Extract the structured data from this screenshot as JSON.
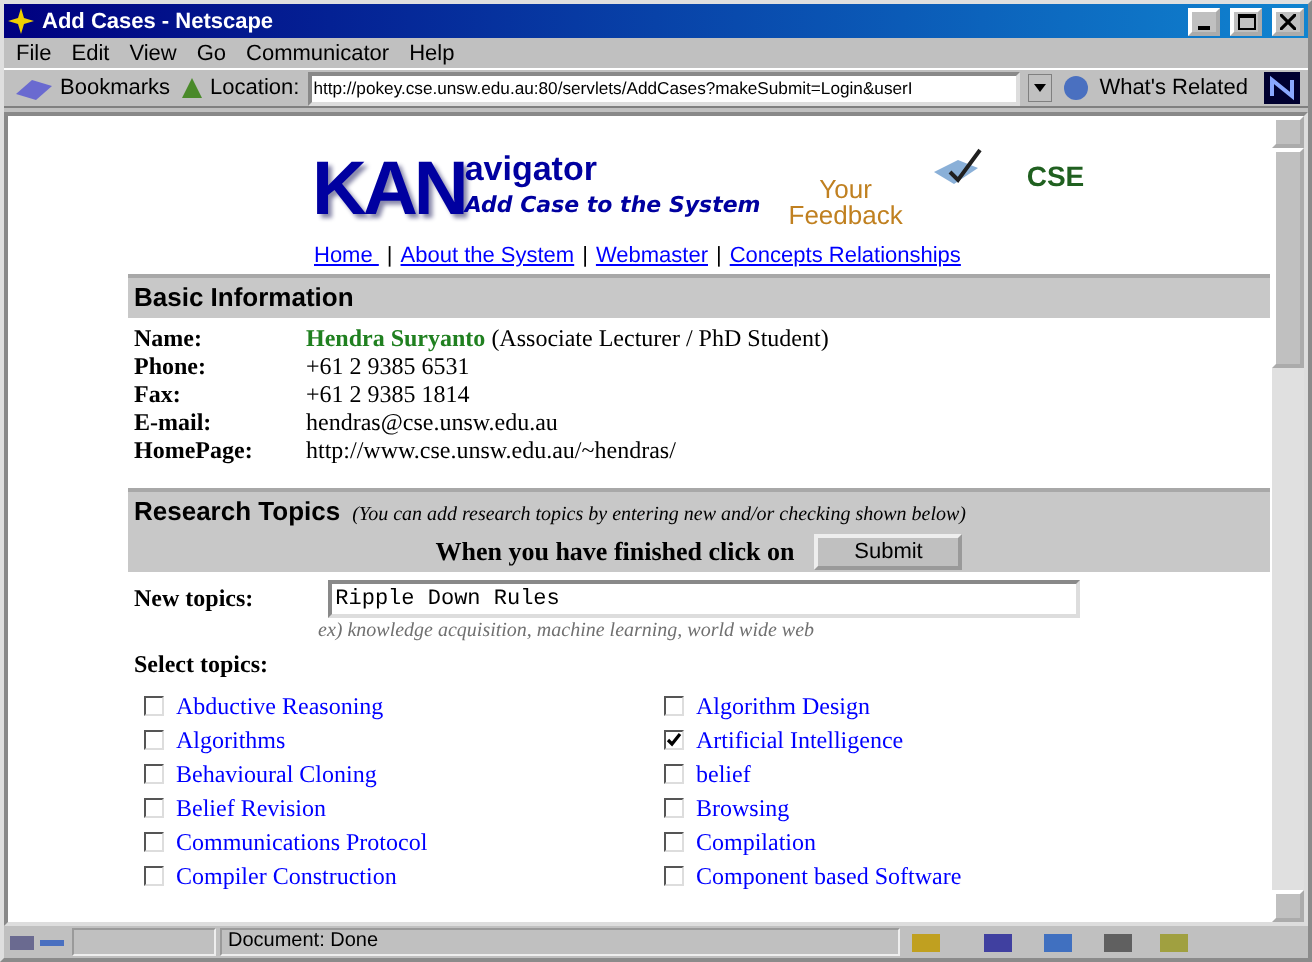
{
  "window": {
    "title": "Add Cases - Netscape"
  },
  "menu": [
    "File",
    "Edit",
    "View",
    "Go",
    "Communicator",
    "Help"
  ],
  "toolbar": {
    "bookmarks": "Bookmarks",
    "location_label": "Location:",
    "url": "http://pokey.cse.unsw.edu.au:80/servlets/AddCases?makeSubmit=Login&userI",
    "related": "What's Related"
  },
  "header": {
    "logo_big": "KAN",
    "logo_small": "avigator",
    "subtitle": "Add Case to the System",
    "feedback": [
      "Your",
      "Feedback"
    ],
    "cse": "CSE"
  },
  "nav": [
    {
      "kind": "link",
      "text": "Home "
    },
    {
      "kind": "separator",
      "text": "|"
    },
    {
      "kind": "link",
      "text": "About the System"
    },
    {
      "kind": "separator",
      "text": "|"
    },
    {
      "kind": "link",
      "text": "Webmaster"
    },
    {
      "kind": "separator",
      "text": "|"
    },
    {
      "kind": "link",
      "text": "Concepts Relationships"
    }
  ],
  "basic_info": {
    "title": "Basic Information",
    "rows": [
      {
        "label": "Name:",
        "value": "Hendra Suryanto",
        "note": "(Associate Lecturer / PhD Student)"
      },
      {
        "label": "Phone:",
        "value": "+61 2 9385 6531"
      },
      {
        "label": "Fax:",
        "value": "+61 2 9385 1814"
      },
      {
        "label": "E-mail:",
        "value": "hendras@cse.unsw.edu.au"
      },
      {
        "label": "HomePage:",
        "value": "http://www.cse.unsw.edu.au/~hendras/"
      }
    ]
  },
  "research": {
    "title": "Research Topics",
    "hint": "(You can add research topics by entering new and/or checking shown below)",
    "submit_prompt": "When you have finished click on",
    "submit": "Submit",
    "new_label": "New topics:",
    "new_value": "Ripple Down Rules",
    "example": "ex) knowledge acquisition, machine learning, world wide web",
    "select_label": "Select topics:",
    "topics": [
      {
        "label": "Abductive Reasoning",
        "checked": false
      },
      {
        "label": "Algorithm Design",
        "checked": false
      },
      {
        "label": "Algorithms",
        "checked": false
      },
      {
        "label": "Artificial Intelligence",
        "checked": true
      },
      {
        "label": "Behavioural Cloning",
        "checked": false
      },
      {
        "label": "belief",
        "checked": false
      },
      {
        "label": "Belief Revision",
        "checked": false
      },
      {
        "label": "Browsing",
        "checked": false
      },
      {
        "label": "Communications Protocol",
        "checked": false
      },
      {
        "label": "Compilation",
        "checked": false
      },
      {
        "label": "Compiler Construction",
        "checked": false
      },
      {
        "label": "Component based Software",
        "checked": false
      }
    ]
  },
  "status_bar": {
    "text": "Document: Done"
  }
}
